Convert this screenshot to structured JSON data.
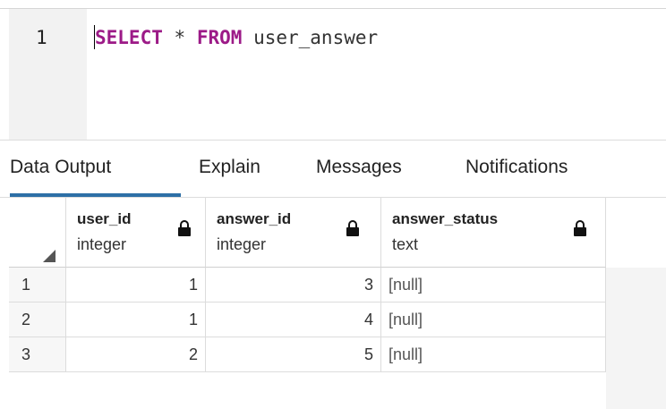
{
  "editor": {
    "line_number": "1",
    "tokens": {
      "select": "SELECT",
      "star": "*",
      "from": "FROM",
      "table": "user_answer"
    }
  },
  "tabs": [
    {
      "label": "Data Output",
      "active": true
    },
    {
      "label": "Explain",
      "active": false
    },
    {
      "label": "Messages",
      "active": false
    },
    {
      "label": "Notifications",
      "active": false
    }
  ],
  "grid": {
    "columns": [
      {
        "name": "user_id",
        "type": "integer"
      },
      {
        "name": "answer_id",
        "type": "integer"
      },
      {
        "name": "answer_status",
        "type": "text"
      }
    ],
    "rows": [
      {
        "n": "1",
        "cells": [
          "1",
          "3",
          "[null]"
        ]
      },
      {
        "n": "2",
        "cells": [
          "1",
          "4",
          "[null]"
        ]
      },
      {
        "n": "3",
        "cells": [
          "2",
          "5",
          "[null]"
        ]
      }
    ]
  },
  "colors": {
    "keyword": "#9c1a87",
    "active_tab_underline": "#2d6fa6"
  }
}
